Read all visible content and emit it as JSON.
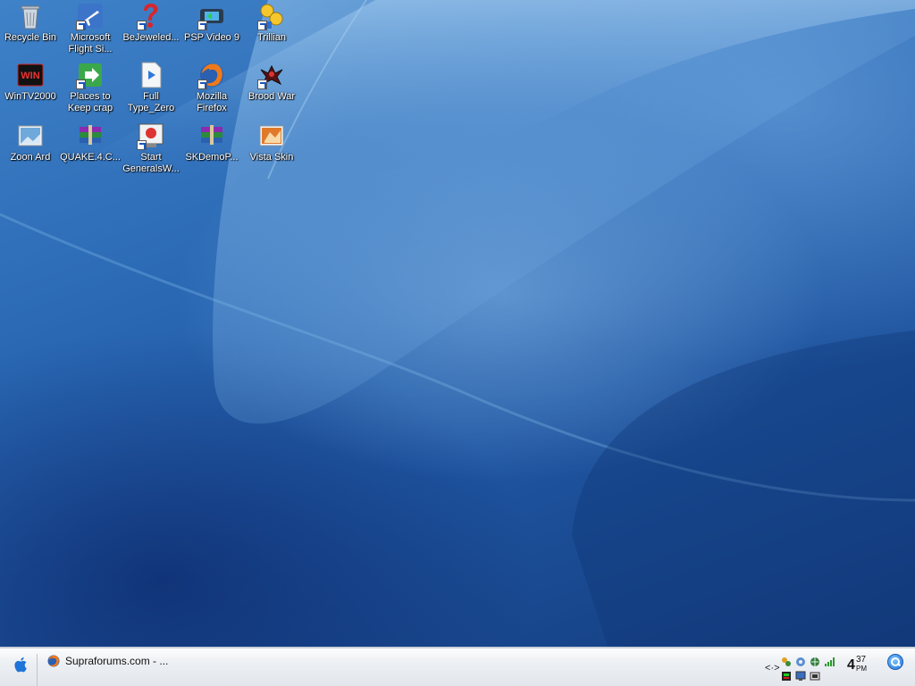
{
  "desktop": {
    "icons": [
      {
        "label": "Recycle Bin",
        "icon": "recycle-bin-icon"
      },
      {
        "label": "Microsoft Flight Si...",
        "icon": "airplane-icon"
      },
      {
        "label": "BeJeweled...",
        "icon": "bejeweled-icon"
      },
      {
        "label": "PSP Video 9",
        "icon": "psp-video-icon"
      },
      {
        "label": "Trillian",
        "icon": "trillian-icon"
      },
      {
        "label": "WinTV2000",
        "icon": "wintv-icon"
      },
      {
        "label": "Places to Keep crap",
        "icon": "folder-shortcut-icon"
      },
      {
        "label": "Full Type_Zero",
        "icon": "media-file-icon"
      },
      {
        "label": "Mozilla Firefox",
        "icon": "firefox-icon"
      },
      {
        "label": "Brood War",
        "icon": "brood-war-icon"
      },
      {
        "label": "Zoon Ard",
        "icon": "image-file-icon"
      },
      {
        "label": "QUAKE.4.C...",
        "icon": "winrar-archive-icon"
      },
      {
        "label": "Start GeneralsW...",
        "icon": "generals-icon"
      },
      {
        "label": "SKDemoP...",
        "icon": "winrar-archive-icon"
      },
      {
        "label": "Vista Skin",
        "icon": "vista-skin-icon"
      }
    ]
  },
  "taskbar": {
    "start_icon": "apple-icon",
    "task_label": "Supraforums.com - ...",
    "tray_arrows": "<·>",
    "clock": {
      "hour": "4",
      "minute": "37",
      "ampm": "PM"
    },
    "search_icon": "search-icon"
  },
  "colors": {
    "desktop_blue": "#2a68b4",
    "taskbar_bg": "#eceff3",
    "accent": "#1f74d8"
  }
}
